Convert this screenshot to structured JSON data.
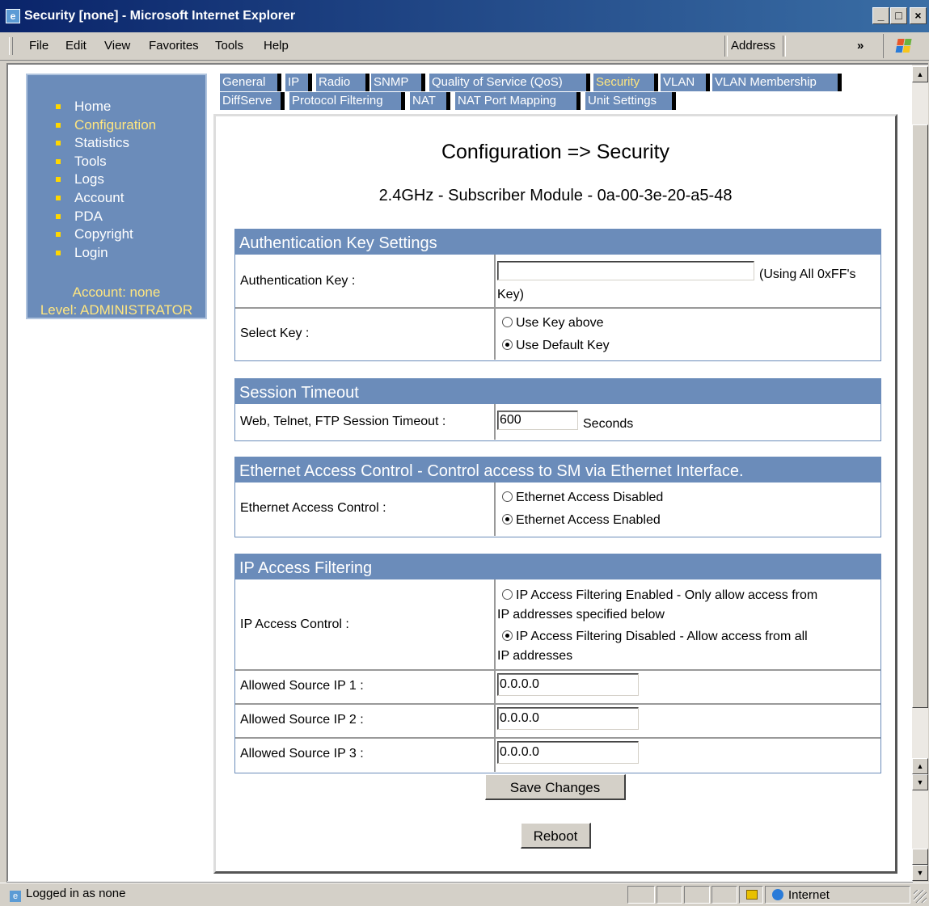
{
  "window": {
    "title": "Security [none] - Microsoft Internet Explorer",
    "icon_glyph": "e",
    "min": "_",
    "max": "□",
    "close": "×"
  },
  "menu": {
    "file": "File",
    "edit": "Edit",
    "view": "View",
    "favorites": "Favorites",
    "tools": "Tools",
    "help": "Help",
    "address": "Address",
    "chevron": "»"
  },
  "nav": {
    "items": [
      "Home",
      "Configuration",
      "Statistics",
      "Tools",
      "Logs",
      "Account",
      "PDA",
      "Copyright",
      "Login"
    ],
    "active": "Configuration",
    "account": "Account: none",
    "level": "Level: ADMINISTRATOR"
  },
  "tabs": {
    "row1": [
      "General",
      "IP",
      "Radio",
      "SNMP",
      "Quality of Service (QoS)",
      "Security",
      "VLAN",
      "VLAN Membership"
    ],
    "row2": [
      "DiffServe",
      "Protocol Filtering",
      "NAT",
      "NAT Port Mapping",
      "Unit Settings"
    ],
    "active": "Security"
  },
  "page": {
    "title": "Configuration => Security",
    "module": "2.4GHz - Subscriber Module - 0a-00-3e-20-a5-48"
  },
  "auth": {
    "heading": "Authentication Key Settings",
    "key_label": "Authentication Key :",
    "key_value": "",
    "key_hint_1": "(Using All 0xFF's",
    "key_hint_2": "Key)",
    "select_label": "Select Key :",
    "opt_above": "Use Key above",
    "opt_default": "Use Default Key",
    "selected": "default"
  },
  "session": {
    "heading": "Session Timeout",
    "label": "Web, Telnet, FTP Session Timeout :",
    "value": "600",
    "unit": "Seconds"
  },
  "ethernet": {
    "heading": "Ethernet Access Control - Control access to SM via Ethernet Interface.",
    "label": "Ethernet Access Control :",
    "opt_disabled": "Ethernet Access Disabled",
    "opt_enabled": "Ethernet Access Enabled",
    "selected": "enabled"
  },
  "ipfilter": {
    "heading": "IP Access Filtering",
    "label": "IP Access Control :",
    "opt_enabled_1": "IP Access Filtering Enabled - Only allow access from",
    "opt_enabled_2": "IP addresses specified below",
    "opt_disabled_1": "IP Access Filtering Disabled - Allow access from all",
    "opt_disabled_2": "IP addresses",
    "selected": "disabled",
    "ip1_label": "Allowed Source IP 1 :",
    "ip1": "0.0.0.0",
    "ip2_label": "Allowed Source IP 2 :",
    "ip2": "0.0.0.0",
    "ip3_label": "Allowed Source IP 3 :",
    "ip3": "0.0.0.0"
  },
  "buttons": {
    "save": "Save Changes",
    "reboot": "Reboot"
  },
  "status": {
    "text": "Logged in as none",
    "zone": "Internet"
  },
  "colors": {
    "nav_bg": "#6b8cba",
    "active_text": "#ffe680",
    "title_bar": "#0a246a"
  }
}
